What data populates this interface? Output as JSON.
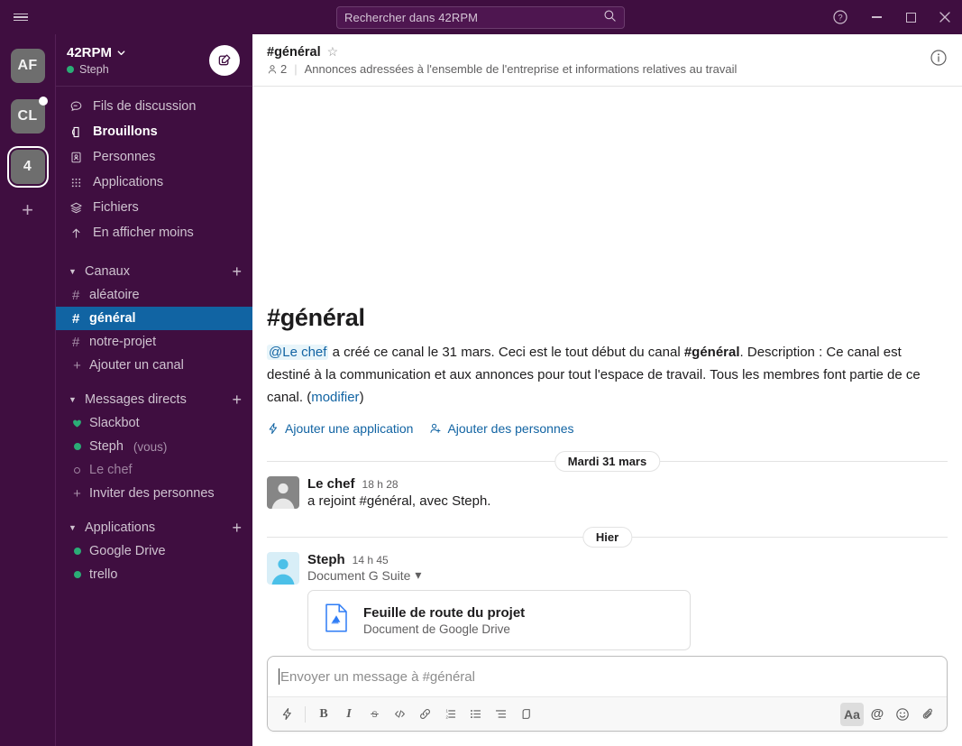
{
  "topbar": {
    "hamburger_icon": "hamburger-icon",
    "back_icon": "arrow-left-icon",
    "forward_icon": "arrow-right-icon",
    "history_icon": "clock-icon",
    "search_placeholder": "Rechercher dans 42RPM",
    "search_icon": "search-icon",
    "help_icon": "help-circle-icon",
    "minimize_label": "minimize",
    "maximize_label": "maximize",
    "close_label": "close"
  },
  "rail": {
    "workspaces": [
      {
        "label": "AF",
        "badge": false,
        "active": false
      },
      {
        "label": "CL",
        "badge": true,
        "active": false
      },
      {
        "label": "4",
        "badge": false,
        "active": true
      }
    ],
    "add_label": "+"
  },
  "sidebar": {
    "workspace_name": "42RPM",
    "workspace_caret": "⌄",
    "user_name": "Steph",
    "compose_icon": "compose-icon",
    "nav": [
      {
        "label": "Fils de discussion",
        "icon": "threads-icon",
        "bold": false
      },
      {
        "label": "Brouillons",
        "icon": "drafts-icon",
        "bold": true
      },
      {
        "label": "Personnes",
        "icon": "people-icon",
        "bold": false
      },
      {
        "label": "Applications",
        "icon": "apps-grid-icon",
        "bold": false
      },
      {
        "label": "Fichiers",
        "icon": "files-icon",
        "bold": false
      },
      {
        "label": "En afficher moins",
        "icon": "arrow-up-icon",
        "bold": false
      }
    ],
    "sections": [
      {
        "title": "Canaux",
        "add_label": "+",
        "items": [
          {
            "label": "aléatoire",
            "prefix": "#",
            "state": "normal"
          },
          {
            "label": "général",
            "prefix": "#",
            "state": "active"
          },
          {
            "label": "notre-projet",
            "prefix": "#",
            "state": "normal"
          },
          {
            "label": "Ajouter un canal",
            "prefix": "+",
            "state": "normal"
          }
        ]
      },
      {
        "title": "Messages directs",
        "add_label": "+",
        "items": [
          {
            "label": "Slackbot",
            "prefix": "heart",
            "state": "normal"
          },
          {
            "label": "Steph",
            "suffix": "(vous)",
            "prefix": "online",
            "state": "normal"
          },
          {
            "label": "Le chef",
            "prefix": "offline",
            "state": "muted"
          },
          {
            "label": "Inviter des personnes",
            "prefix": "+",
            "state": "normal"
          }
        ]
      },
      {
        "title": "Applications",
        "add_label": "+",
        "items": [
          {
            "label": "Google Drive",
            "prefix": "online",
            "state": "normal"
          },
          {
            "label": "trello",
            "prefix": "online",
            "state": "normal"
          }
        ]
      }
    ]
  },
  "channel": {
    "name": "#général",
    "star_icon": "star-icon",
    "member_icon": "member-icon",
    "member_count": "2",
    "topic": "Annonces adressées à l'ensemble de l'entreprise et informations relatives au travail",
    "info_icon": "info-circle-icon"
  },
  "intro": {
    "heading": "#général",
    "mention": "@Le chef",
    "text_1": " a créé ce canal le 31 mars. Ceci est le tout début du canal ",
    "bold_channel": "#général",
    "text_2": ". Description : Ce canal est destiné à la communication et aux annonces pour tout l'espace de travail. Tous les membres font partie de ce canal. (",
    "edit_link": "modifier",
    "text_3": ")",
    "action_app": "Ajouter une application",
    "action_app_icon": "add-app-icon",
    "action_people": "Ajouter des personnes",
    "action_people_icon": "add-person-icon"
  },
  "messages": [
    {
      "type": "divider",
      "label": "Mardi 31 mars"
    },
    {
      "type": "message",
      "author": "Le chef",
      "time": "18 h 28",
      "text": "a rejoint #général, avec Steph.",
      "avatar_color": "#868686"
    },
    {
      "type": "divider",
      "label": "Hier"
    },
    {
      "type": "message",
      "author": "Steph",
      "time": "14 h 45",
      "subtitle": "Document G Suite",
      "subtitle_caret": "▾",
      "avatar_color": "#4BC0E8",
      "attachment": {
        "icon": "google-drive-file-icon",
        "title": "Feuille de route du projet",
        "subtitle": "Document de Google Drive"
      }
    }
  ],
  "composer": {
    "placeholder": "Envoyer un message à #général",
    "tools": [
      {
        "name": "shortcuts-icon",
        "glyph": "⚡",
        "active": false
      },
      {
        "name": "bold-icon",
        "glyph": "B",
        "active": false
      },
      {
        "name": "italic-icon",
        "glyph": "I",
        "active": false
      },
      {
        "name": "strikethrough-icon",
        "glyph": "S",
        "active": false
      },
      {
        "name": "code-icon",
        "glyph": "‹›",
        "active": false
      },
      {
        "name": "link-icon",
        "glyph": "🔗",
        "active": false
      },
      {
        "name": "ordered-list-icon",
        "glyph": "1≡",
        "active": false
      },
      {
        "name": "bulleted-list-icon",
        "glyph": "☰",
        "active": false
      },
      {
        "name": "blockquote-icon",
        "glyph": "≡",
        "active": false
      },
      {
        "name": "code-block-icon",
        "glyph": "⎘",
        "active": false
      }
    ],
    "right_tools": [
      {
        "name": "formatting-icon",
        "glyph": "Aa",
        "active": true
      },
      {
        "name": "mention-icon",
        "glyph": "@",
        "active": false
      },
      {
        "name": "emoji-icon",
        "glyph": "☺",
        "active": false
      },
      {
        "name": "attachment-icon",
        "glyph": "📎",
        "active": false
      }
    ]
  },
  "colors": {
    "sidebar_bg": "#3F0E40",
    "active_channel": "#1164A3",
    "link": "#1264A3",
    "online_green": "#2BAC76"
  }
}
